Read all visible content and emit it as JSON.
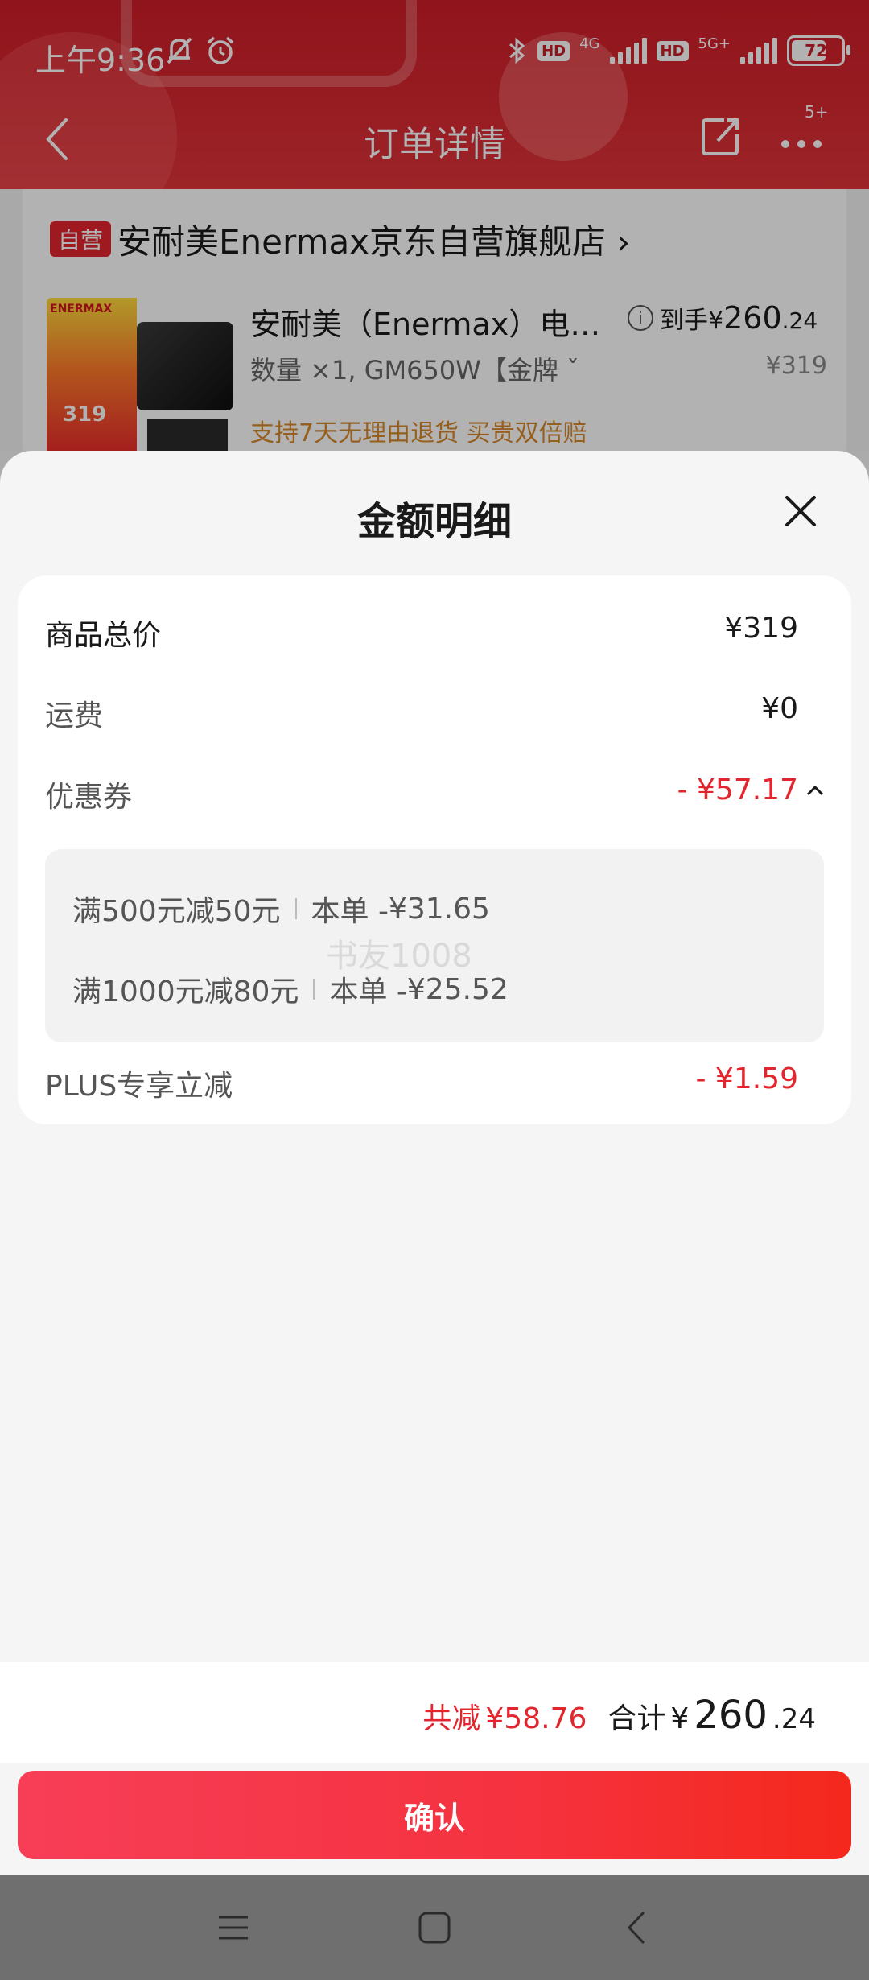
{
  "status_bar": {
    "time": "上午9:36",
    "network1": "4G",
    "network2": "5G+",
    "hd": "HD",
    "battery": "72",
    "battery_level": 0.72
  },
  "nav": {
    "title": "订单详情",
    "more_badge": "5+"
  },
  "store": {
    "self_tag": "自营",
    "name": "安耐美Enermax京东自营旗舰店",
    "chevron": "›"
  },
  "product": {
    "title": "安耐美（Enermax）电…",
    "spec": "数量 ×1, GM650W【金牌 ˇ",
    "service": "支持7天无理由退货   买贵双倍赔",
    "price_label": "到手¥",
    "price_int": "260",
    "price_dec": ".24",
    "original_price": "¥319",
    "image_brand": "ENERMAX",
    "image_price": "319"
  },
  "sheet": {
    "title": "金额明细",
    "rows": {
      "total_label": "商品总价",
      "total_value": "¥319",
      "shipping_label": "运费",
      "shipping_value": "¥0",
      "coupon_label": "优惠券",
      "coupon_value": "- ¥57.17",
      "plus_label": "PLUS专享立减",
      "plus_value": "- ¥1.59"
    },
    "coupons": [
      {
        "rule": "满500元减50元",
        "amount_label": "本单 -",
        "amount": "¥31.65"
      },
      {
        "rule": "满1000元减80元",
        "amount_label": "本单 -",
        "amount": "¥25.52"
      }
    ],
    "watermark": "书友1008"
  },
  "summary": {
    "saved_label": "共减",
    "saved_amount": "¥58.76",
    "total_label": "合计",
    "total_yen": "¥",
    "total_int": "260",
    "total_dec": ".24"
  },
  "confirm_label": "确认",
  "colors": {
    "accent_red": "#e3262e",
    "header_red": "#cf1d28",
    "service_orange": "#d7892a"
  }
}
